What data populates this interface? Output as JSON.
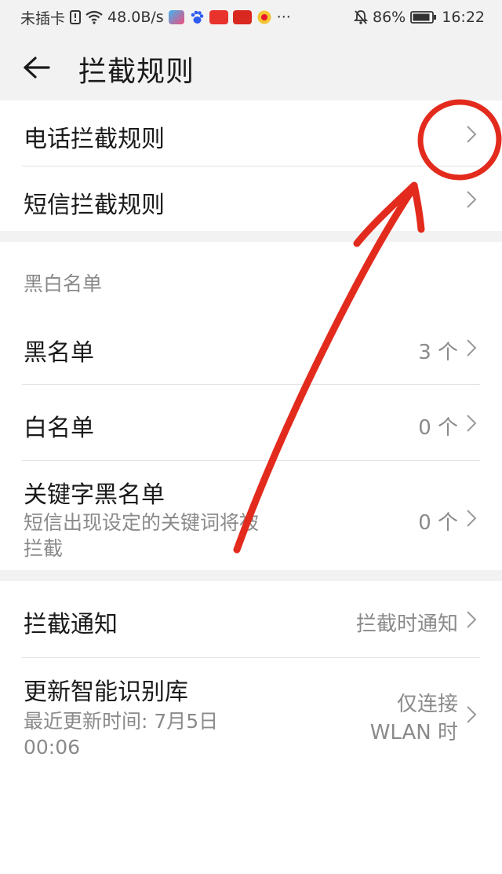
{
  "status_bar": {
    "carrier": "未插卡",
    "net_speed": "48.0B/s",
    "app_icons": [
      "video-app-icon",
      "baidu-paw-icon",
      "toutiao-icon",
      "kuaibao-icon",
      "weibo-icon"
    ],
    "more": "···",
    "battery": "86%",
    "time": "16:22"
  },
  "header": {
    "title": "拦截规则",
    "back_icon": "arrow-left-icon"
  },
  "rules_section": {
    "items": [
      {
        "label": "电话拦截规则"
      },
      {
        "label": "短信拦截规则"
      }
    ]
  },
  "lists_section": {
    "header": "黑白名单",
    "items": [
      {
        "label": "黑名单",
        "value": "3 个"
      },
      {
        "label": "白名单",
        "value": "0 个"
      },
      {
        "label": "关键字黑名单",
        "subtitle_line1": "短信出现设定的关键词将被",
        "subtitle_line2": "拦截",
        "value": "0 个"
      }
    ]
  },
  "misc_section": {
    "items": [
      {
        "label": "拦截通知",
        "value": "拦截时通知"
      },
      {
        "label": "更新智能识别库",
        "subtitle_line1": "最近更新时间: 7月5日",
        "subtitle_line2": "00:06",
        "value_line1": "仅连接",
        "value_line2": "WLAN 时"
      }
    ]
  },
  "colors": {
    "background": "#f2f2f2",
    "surface": "#ffffff",
    "text_primary": "#1a1a1a",
    "text_secondary": "#8a8a8a",
    "annotation": "#e32b1d"
  }
}
